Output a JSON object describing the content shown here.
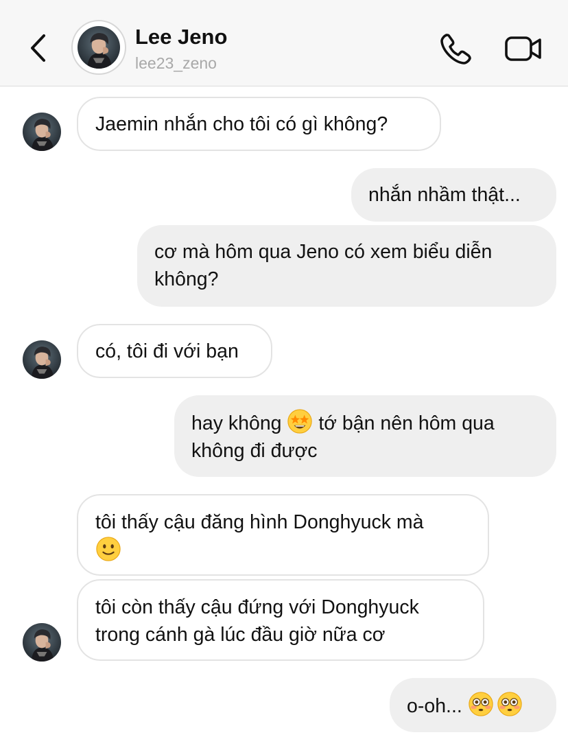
{
  "header": {
    "contact_name": "Lee Jeno",
    "contact_username": "lee23_zeno",
    "back_icon": "chevron-left-icon",
    "call_icon": "phone-icon",
    "video_icon": "video-camera-icon"
  },
  "messages": [
    {
      "from": "them",
      "text": "Jaemin nhắn cho tôi có gì không?"
    },
    {
      "from": "me",
      "text": "nhắn nhầm thật..."
    },
    {
      "from": "me",
      "text": "cơ mà hôm qua Jeno có xem biểu diễn không?",
      "line1": "cơ mà hôm qua Jeno có xem biểu diễn",
      "line2": "không?"
    },
    {
      "from": "them",
      "text": "có, tôi đi với bạn"
    },
    {
      "from": "me",
      "line1_a": "hay không",
      "emoji": "star-struck-emoji",
      "line1_b": "tớ bận nên hôm qua",
      "line2": "không đi được"
    },
    {
      "from": "them",
      "line1": "tôi thấy cậu đăng hình Donghyuck mà",
      "emoji": "slightly-smiling-face-emoji"
    },
    {
      "from": "them",
      "line1": "tôi còn thấy cậu đứng với Donghyuck",
      "line2": "trong cánh gà lúc đầu giờ nữa cơ"
    },
    {
      "from": "me",
      "text": "o-oh...",
      "emoji": "flushed-face-emoji"
    }
  ],
  "colors": {
    "header_bg": "#f7f7f7",
    "incoming_border": "#e3e3e3",
    "outgoing_bg": "#efefef",
    "username_gray": "#a8a8a8"
  }
}
